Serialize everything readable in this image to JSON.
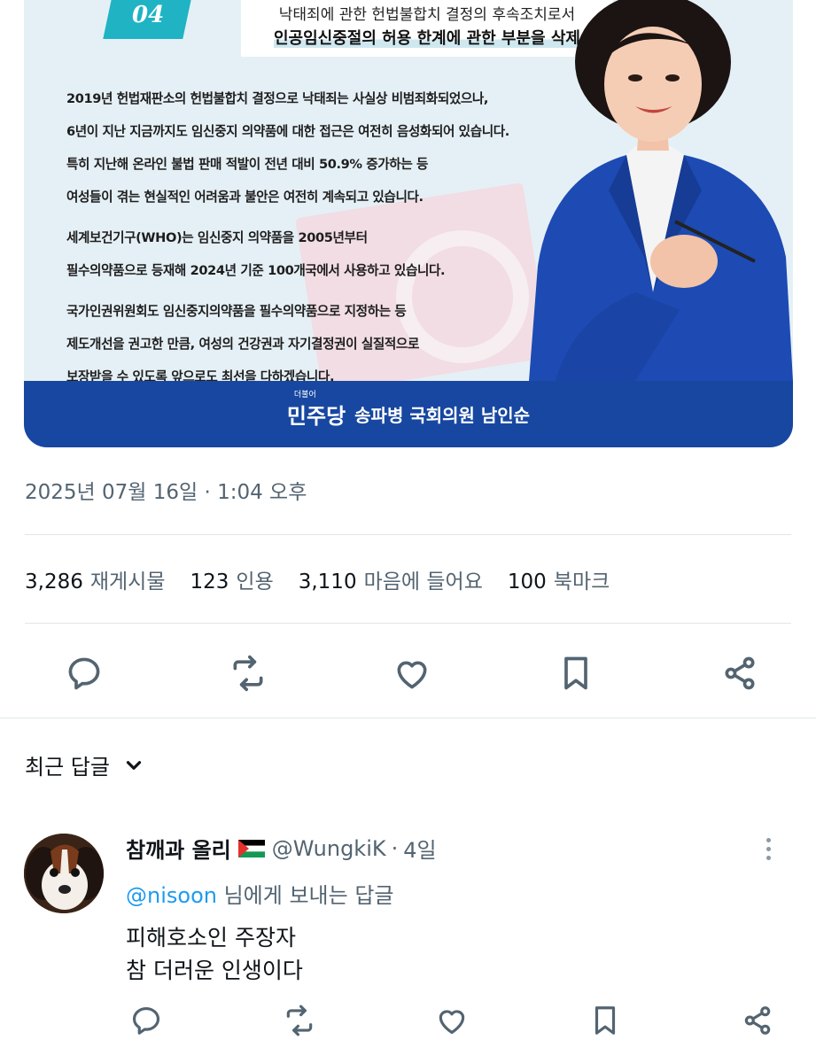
{
  "card": {
    "number": "04",
    "heading_line1": "낙태죄에 관한 헌법불합치 결정의 후속조치로서",
    "heading_line2": "인공임신중절의 허용 한계에 관한 부분을 삭제",
    "paragraphs": [
      [
        "2019년 헌법재판소의 헌법불합치 결정으로 낙태죄는 사실상 비범죄화되었으나,",
        "6년이 지난 지금까지도 임신중지 의약품에 대한 접근은 여전히 음성화되어 있습니다.",
        "특히 지난해 온라인 불법 판매 적발이 전년 대비 50.9% 증가하는 등",
        "여성들이 겪는 현실적인 어려움과 불안은 여전히 계속되고 있습니다."
      ],
      [
        "세계보건기구(WHO)는 임신중지 의약품을 2005년부터",
        "필수의약품으로  등재해  2024년 기준 100개국에서 사용하고 있습니다."
      ],
      [
        "국가인권위원회도 임신중지의약품을 필수의약품으로 지정하는 등",
        "제도개선을 권고한 만큼, 여성의 건강권과 자기결정권이 실질적으로",
        "보장받을 수 있도록 앞으로도 최선을 다하겠습니다."
      ]
    ],
    "party_small": "더불어",
    "party": "민주당",
    "representative": "송파병 국회의원 남인순"
  },
  "timestamp": "2025년 07월 16일 · 1:04 오후",
  "stats": [
    {
      "count": "3,286",
      "label": "재게시물"
    },
    {
      "count": "123",
      "label": "인용"
    },
    {
      "count": "3,110",
      "label": "마음에 들어요"
    },
    {
      "count": "100",
      "label": "북마크"
    }
  ],
  "actions": [
    "reply-icon",
    "repost-icon",
    "like-icon",
    "bookmark-icon",
    "share-icon"
  ],
  "recent_replies_label": "최근 답글",
  "reply": {
    "name": "참깨과 올리",
    "handle": "@WungkiK",
    "dot": "·",
    "time": "4일",
    "reply_to_mention": "@nisoon",
    "reply_to_suffix": " 님에게 보내는 답글",
    "text_line1": "피해호소인 주장자",
    "text_line2": "참 더러운 인생이다"
  },
  "colors": {
    "accent": "#1d9bf0",
    "muted": "#536471",
    "party_blue": "#1747a0",
    "badge_teal": "#1fb3c4"
  }
}
